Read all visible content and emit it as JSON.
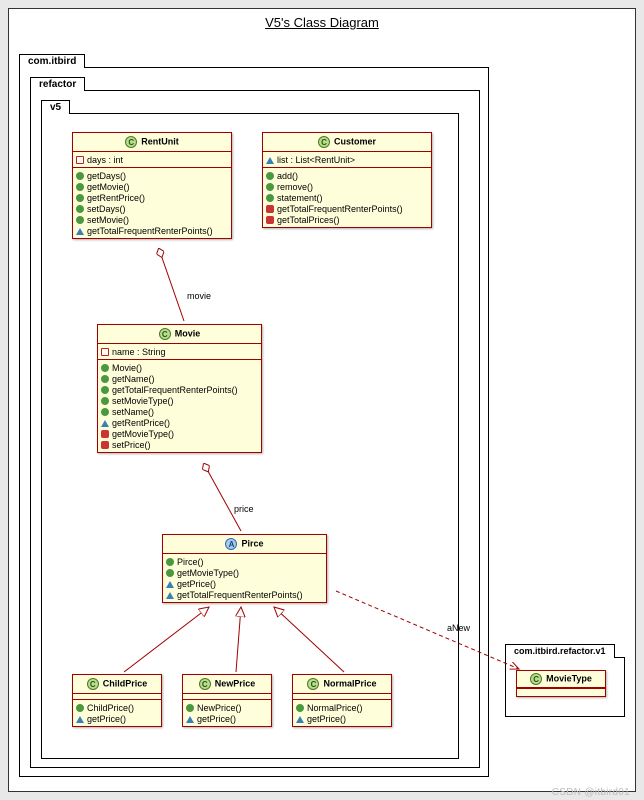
{
  "title": "V5's Class Diagram",
  "packages": {
    "p1": "com.itbird",
    "p2": "refactor",
    "p3": "v5",
    "p4": "com.itbird.refactor.v1"
  },
  "edges": {
    "movie": "movie",
    "price": "price",
    "anew": "aNew"
  },
  "classes": {
    "rentUnit": {
      "name": "RentUnit",
      "stereo": "C",
      "attrs": [
        {
          "sym": "field",
          "text": "days : int"
        }
      ],
      "ops": [
        {
          "sym": "pub",
          "text": "getDays()"
        },
        {
          "sym": "pub",
          "text": "getMovie()"
        },
        {
          "sym": "pub",
          "text": "getRentPrice()"
        },
        {
          "sym": "pub",
          "text": "setDays()"
        },
        {
          "sym": "pub",
          "text": "setMovie()"
        },
        {
          "sym": "pubtri",
          "text": "getTotalFrequentRenterPoints()"
        }
      ]
    },
    "customer": {
      "name": "Customer",
      "stereo": "C",
      "attrs": [
        {
          "sym": "tri",
          "text": "list : List<RentUnit>"
        }
      ],
      "ops": [
        {
          "sym": "pub",
          "text": "add()"
        },
        {
          "sym": "pub",
          "text": "remove()"
        },
        {
          "sym": "pub",
          "text": "statement()"
        },
        {
          "sym": "priv",
          "text": "getTotalFrequentRenterPoints()"
        },
        {
          "sym": "priv",
          "text": "getTotalPrices()"
        }
      ]
    },
    "movie": {
      "name": "Movie",
      "stereo": "C",
      "attrs": [
        {
          "sym": "field",
          "text": "name : String"
        }
      ],
      "ops": [
        {
          "sym": "pub",
          "text": "Movie()"
        },
        {
          "sym": "pub",
          "text": "getName()"
        },
        {
          "sym": "pub",
          "text": "getTotalFrequentRenterPoints()"
        },
        {
          "sym": "pub",
          "text": "setMovieType()"
        },
        {
          "sym": "pub",
          "text": "setName()"
        },
        {
          "sym": "pubtri",
          "text": "getRentPrice()"
        },
        {
          "sym": "priv",
          "text": "getMovieType()"
        },
        {
          "sym": "priv",
          "text": "setPrice()"
        }
      ]
    },
    "pirce": {
      "name": "Pirce",
      "stereo": "A",
      "ops": [
        {
          "sym": "pub",
          "text": "Pirce()"
        },
        {
          "sym": "pub",
          "text": "getMovieType()"
        },
        {
          "sym": "pubtri",
          "text": "getPrice()"
        },
        {
          "sym": "pubtri",
          "text": "getTotalFrequentRenterPoints()"
        }
      ]
    },
    "childPrice": {
      "name": "ChildPrice",
      "stereo": "C",
      "ops": [
        {
          "sym": "pub",
          "text": "ChildPrice()"
        },
        {
          "sym": "pubtri",
          "text": "getPrice()"
        }
      ]
    },
    "newPrice": {
      "name": "NewPrice",
      "stereo": "C",
      "ops": [
        {
          "sym": "pub",
          "text": "NewPrice()"
        },
        {
          "sym": "pubtri",
          "text": "getPrice()"
        }
      ]
    },
    "normalPrice": {
      "name": "NormalPrice",
      "stereo": "C",
      "ops": [
        {
          "sym": "pub",
          "text": "NormalPrice()"
        },
        {
          "sym": "pubtri",
          "text": "getPrice()"
        }
      ]
    },
    "movieType": {
      "name": "MovieType",
      "stereo": "C"
    }
  },
  "watermark": "CSDN @itbird01"
}
